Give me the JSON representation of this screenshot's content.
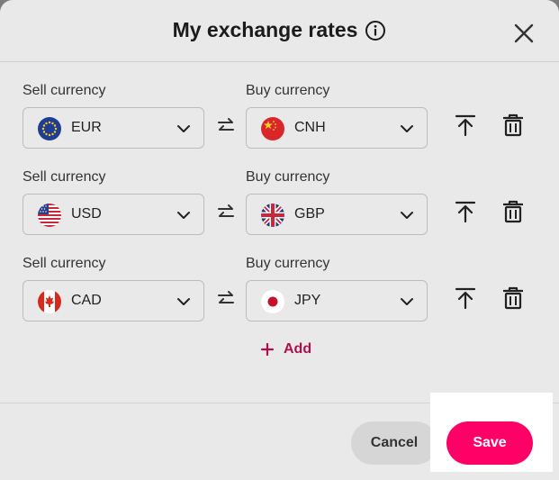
{
  "dialog": {
    "title": "My exchange rates",
    "info_icon": "info-icon",
    "close_icon": "close-icon"
  },
  "pairs": [
    {
      "sell_label": "Sell currency",
      "sell": "EUR",
      "sell_flag": "eu-flag-icon",
      "buy_label": "Buy currency",
      "buy": "CNH",
      "buy_flag": "china-flag-icon"
    },
    {
      "sell_label": "Sell currency",
      "sell": "USD",
      "sell_flag": "us-flag-icon",
      "buy_label": "Buy currency",
      "buy": "GBP",
      "buy_flag": "uk-flag-icon"
    },
    {
      "sell_label": "Sell currency",
      "sell": "CAD",
      "sell_flag": "canada-flag-icon",
      "buy_label": "Buy currency",
      "buy": "JPY",
      "buy_flag": "japan-flag-icon"
    }
  ],
  "row_actions": {
    "move_top_icon": "move-to-top-icon",
    "delete_icon": "trash-icon",
    "swap_icon": "swap-icon"
  },
  "add": {
    "label": "Add",
    "icon": "plus-icon"
  },
  "footer": {
    "cancel_label": "Cancel",
    "save_label": "Save"
  },
  "colors": {
    "accent": "#ff0066",
    "add_text": "#b00f4e",
    "overlay": "#7c7c7c"
  }
}
